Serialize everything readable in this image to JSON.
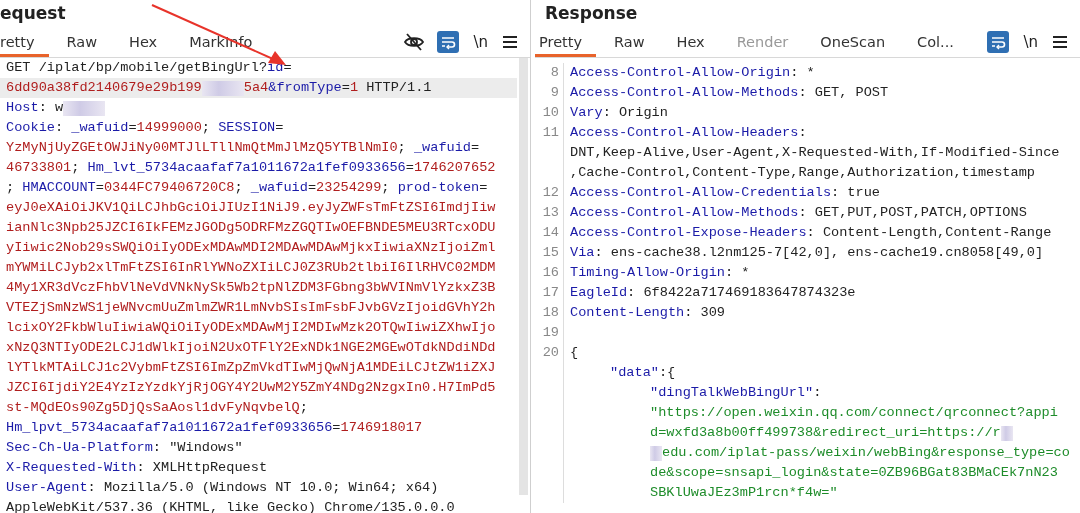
{
  "request": {
    "title": "equest",
    "tabs": [
      {
        "label": "retty",
        "selected": true,
        "disabled": false
      },
      {
        "label": "Raw",
        "selected": false,
        "disabled": false
      },
      {
        "label": "Hex",
        "selected": false,
        "disabled": false
      },
      {
        "label": "MarkInfo",
        "selected": false,
        "disabled": false
      }
    ],
    "toolbar": {
      "newline_label": "\\n"
    },
    "lines": [
      {
        "highlighted": false,
        "segments": [
          {
            "kind": "plain",
            "text": "GET /iplat/bp/mobile/getBingUrl?"
          },
          {
            "kind": "key",
            "text": "id"
          },
          {
            "kind": "plain",
            "text": "="
          }
        ]
      },
      {
        "highlighted": true,
        "segments": [
          {
            "kind": "value",
            "text": "6dd90a38fd2140679e29b199"
          },
          {
            "kind": "redacted"
          },
          {
            "kind": "value",
            "text": "5a4"
          },
          {
            "kind": "key",
            "text": "&fromType"
          },
          {
            "kind": "plain",
            "text": "="
          },
          {
            "kind": "value",
            "text": "1"
          },
          {
            "kind": "plain",
            "text": " HTTP/1.1"
          }
        ]
      },
      {
        "highlighted": false,
        "segments": [
          {
            "kind": "key",
            "text": "Host"
          },
          {
            "kind": "plain",
            "text": ": w"
          },
          {
            "kind": "redacted"
          }
        ]
      },
      {
        "highlighted": false,
        "segments": [
          {
            "kind": "key",
            "text": "Cookie"
          },
          {
            "kind": "plain",
            "text": ": "
          },
          {
            "kind": "key",
            "text": "_wafuid"
          },
          {
            "kind": "plain",
            "text": "="
          },
          {
            "kind": "value",
            "text": "14999000"
          },
          {
            "kind": "plain",
            "text": "; "
          },
          {
            "kind": "key",
            "text": "SESSION"
          },
          {
            "kind": "plain",
            "text": "="
          }
        ]
      },
      {
        "highlighted": false,
        "segments": [
          {
            "kind": "value",
            "text": "YzMyNjUyZGEtOWJiNy00MTJlLTllNmQtMmJlMzQ5YTBlNmI0"
          },
          {
            "kind": "plain",
            "text": "; "
          },
          {
            "kind": "key",
            "text": "_wafuid"
          },
          {
            "kind": "plain",
            "text": "="
          }
        ]
      },
      {
        "highlighted": false,
        "segments": [
          {
            "kind": "value",
            "text": "46733801"
          },
          {
            "kind": "plain",
            "text": "; "
          },
          {
            "kind": "key",
            "text": "Hm_lvt_5734acaafaf7a1011672a1fef0933656"
          },
          {
            "kind": "plain",
            "text": "="
          },
          {
            "kind": "value",
            "text": "1746207652"
          }
        ]
      },
      {
        "highlighted": false,
        "segments": [
          {
            "kind": "plain",
            "text": "; "
          },
          {
            "kind": "key",
            "text": "HMACCOUNT"
          },
          {
            "kind": "plain",
            "text": "="
          },
          {
            "kind": "value",
            "text": "0344FC79406720C8"
          },
          {
            "kind": "plain",
            "text": "; "
          },
          {
            "kind": "key",
            "text": "_wafuid"
          },
          {
            "kind": "plain",
            "text": "="
          },
          {
            "kind": "value",
            "text": "23254299"
          },
          {
            "kind": "plain",
            "text": "; "
          },
          {
            "kind": "key",
            "text": "prod-token"
          },
          {
            "kind": "plain",
            "text": "="
          }
        ]
      },
      {
        "highlighted": false,
        "segments": [
          {
            "kind": "value",
            "text": "eyJ0eXAiOiJKV1QiLCJhbGciOiJIUzI1NiJ9.eyJyZWFsTmFtZSI6ImdjIiw"
          }
        ]
      },
      {
        "highlighted": false,
        "segments": [
          {
            "kind": "value",
            "text": "ianNlc3Npb25JZCI6IkFEMzJGODg5ODRFMzZGQTIwOEFBNDE5MEU3RTcxODU"
          }
        ]
      },
      {
        "highlighted": false,
        "segments": [
          {
            "kind": "value",
            "text": "yIiwic2Nob29sSWQiOiIyODExMDAwMDI2MDAwMDAwMjkxIiwiaXNzIjoiZml"
          }
        ]
      },
      {
        "highlighted": false,
        "segments": [
          {
            "kind": "value",
            "text": "mYWMiLCJyb2xlTmFtZSI6InRlYWNoZXIiLCJ0Z3RUb2tlbiI6IlRHVC02MDM"
          }
        ]
      },
      {
        "highlighted": false,
        "segments": [
          {
            "kind": "value",
            "text": "4My1XR3dVczFhbVlNeVdVNkNySk5Wb2tpNlZDM3FGbng3bWVINmVlYzkxZ3B"
          }
        ]
      },
      {
        "highlighted": false,
        "segments": [
          {
            "kind": "value",
            "text": "VTEZjSmNzWS1jeWNvcmUuZmlmZWR1LmNvbSIsImFsbFJvbGVzIjoidGVhY2h"
          }
        ]
      },
      {
        "highlighted": false,
        "segments": [
          {
            "kind": "value",
            "text": "lcixOY2FkbWluIiwiaWQiOiIyODExMDAwMjI2MDIwMzk2OTQwIiwiZXhwIjo"
          }
        ]
      },
      {
        "highlighted": false,
        "segments": [
          {
            "kind": "value",
            "text": "xNzQ3NTIyODE2LCJ1dWlkIjoiN2UxOTFlY2ExNDk1NGE2MGEwOTdkNDdiNDd"
          }
        ]
      },
      {
        "highlighted": false,
        "segments": [
          {
            "kind": "value",
            "text": "lYTlkMTAiLCJ1c2VybmFtZSI6ImZpZmVkdTIwMjQwNjA1MDEiLCJtZW1iZXJ"
          }
        ]
      },
      {
        "highlighted": false,
        "segments": [
          {
            "kind": "value",
            "text": "JZCI6IjdiY2E4YzIzYzdkYjRjOGY4Y2UwM2Y5ZmY4NDg2NzgxIn0.H7ImPd5"
          }
        ]
      },
      {
        "highlighted": false,
        "segments": [
          {
            "kind": "value",
            "text": "st-MQdEOs90Zg5DjQsSaAosl1dvFyNqvbelQ"
          },
          {
            "kind": "plain",
            "text": ";"
          }
        ]
      },
      {
        "highlighted": false,
        "segments": [
          {
            "kind": "key",
            "text": "Hm_lpvt_5734acaafaf7a1011672a1fef0933656"
          },
          {
            "kind": "plain",
            "text": "="
          },
          {
            "kind": "value",
            "text": "1746918017"
          }
        ]
      },
      {
        "highlighted": false,
        "segments": [
          {
            "kind": "key",
            "text": "Sec-Ch-Ua-Platform"
          },
          {
            "kind": "plain",
            "text": ": \"Windows\""
          }
        ]
      },
      {
        "highlighted": false,
        "segments": [
          {
            "kind": "key",
            "text": "X-Requested-With"
          },
          {
            "kind": "plain",
            "text": ": XMLHttpRequest"
          }
        ]
      },
      {
        "highlighted": false,
        "segments": [
          {
            "kind": "key",
            "text": "User-Agent"
          },
          {
            "kind": "plain",
            "text": ": Mozilla/5.0 (Windows NT 10.0; Win64; x64)"
          }
        ]
      },
      {
        "highlighted": false,
        "segments": [
          {
            "kind": "plain",
            "text": "AppleWebKit/537.36 (KHTML, like Gecko) Chrome/135.0.0.0"
          }
        ]
      }
    ]
  },
  "response": {
    "title": "Response",
    "tabs": [
      {
        "label": "Pretty",
        "selected": true,
        "disabled": false
      },
      {
        "label": "Raw",
        "selected": false,
        "disabled": false
      },
      {
        "label": "Hex",
        "selected": false,
        "disabled": false
      },
      {
        "label": "Render",
        "selected": false,
        "disabled": true
      },
      {
        "label": "OneScan",
        "selected": false,
        "disabled": false
      },
      {
        "label": "Col...",
        "selected": false,
        "disabled": false
      }
    ],
    "toolbar": {
      "newline_label": "\\n"
    },
    "lines": [
      {
        "number": "8",
        "rows": [
          [
            {
              "kind": "key",
              "text": "Access-Control-Allow-Origin"
            },
            {
              "kind": "plain",
              "text": ": *"
            }
          ]
        ]
      },
      {
        "number": "9",
        "rows": [
          [
            {
              "kind": "key",
              "text": "Access-Control-Allow-Methods"
            },
            {
              "kind": "plain",
              "text": ": GET, POST"
            }
          ]
        ]
      },
      {
        "number": "10",
        "rows": [
          [
            {
              "kind": "key",
              "text": "Vary"
            },
            {
              "kind": "plain",
              "text": ": Origin"
            }
          ]
        ]
      },
      {
        "number": "11",
        "rows": [
          [
            {
              "kind": "key",
              "text": "Access-Control-Allow-Headers"
            },
            {
              "kind": "plain",
              "text": ":"
            }
          ],
          [
            {
              "kind": "plain",
              "text": "DNT,Keep-Alive,User-Agent,X-Requested-With,If-Modified-Since"
            }
          ],
          [
            {
              "kind": "plain",
              "text": ",Cache-Control,Content-Type,Range,Authorization,timestamp"
            }
          ]
        ]
      },
      {
        "number": "12",
        "rows": [
          [
            {
              "kind": "key",
              "text": "Access-Control-Allow-Credentials"
            },
            {
              "kind": "plain",
              "text": ": true"
            }
          ]
        ]
      },
      {
        "number": "13",
        "rows": [
          [
            {
              "kind": "key",
              "text": "Access-Control-Allow-Methods"
            },
            {
              "kind": "plain",
              "text": ": GET,PUT,POST,PATCH,OPTIONS"
            }
          ]
        ]
      },
      {
        "number": "14",
        "rows": [
          [
            {
              "kind": "key",
              "text": "Access-Control-Expose-Headers"
            },
            {
              "kind": "plain",
              "text": ": Content-Length,Content-Range"
            }
          ]
        ]
      },
      {
        "number": "15",
        "rows": [
          [
            {
              "kind": "key",
              "text": "Via"
            },
            {
              "kind": "plain",
              "text": ": ens-cache38.l2nm125-7[42,0], ens-cache19.cn8058[49,0]"
            }
          ]
        ]
      },
      {
        "number": "16",
        "rows": [
          [
            {
              "kind": "key",
              "text": "Timing-Allow-Origin"
            },
            {
              "kind": "plain",
              "text": ": *"
            }
          ]
        ]
      },
      {
        "number": "17",
        "rows": [
          [
            {
              "kind": "key",
              "text": "EagleId"
            },
            {
              "kind": "plain",
              "text": ": 6f8422a717469183647874323e"
            }
          ]
        ]
      },
      {
        "number": "18",
        "rows": [
          [
            {
              "kind": "key",
              "text": "Content-Length"
            },
            {
              "kind": "plain",
              "text": ": 309"
            }
          ]
        ]
      },
      {
        "number": "19",
        "rows": [
          []
        ]
      },
      {
        "number": "20",
        "rows": [
          [
            {
              "kind": "plain",
              "text": "{"
            }
          ]
        ],
        "children": [
          {
            "rows": [
              [
                {
                  "kind": "key",
                  "text": "\"data\""
                },
                {
                  "kind": "plain",
                  "text": ":{"
                }
              ]
            ],
            "children": [
              {
                "rows": [
                  [
                    {
                      "kind": "key",
                      "text": "\"dingTalkWebBingUrl\""
                    },
                    {
                      "kind": "plain",
                      "text": ":"
                    }
                  ],
                  [
                    {
                      "kind": "string",
                      "text": "\"https://open.weixin.qq.com/connect/qrconnect?appi"
                    }
                  ],
                  [
                    {
                      "kind": "string",
                      "text": "d=wxfd3a8b00ff499738&redirect_uri=https://r"
                    },
                    {
                      "kind": "redacted"
                    }
                  ],
                  [
                    {
                      "kind": "redacted"
                    },
                    {
                      "kind": "string",
                      "text": "edu.com/iplat-pass/weixin/webBing&response_type=co"
                    }
                  ],
                  [
                    {
                      "kind": "string",
                      "text": "de&scope=snsapi_login&state=0ZB96BGat83BMaCEk7nN23"
                    }
                  ],
                  [
                    {
                      "kind": "string",
                      "text": "SBKlUwaJEz3mP1rcn*f4w=\""
                    }
                  ]
                ]
              }
            ]
          }
        ]
      }
    ]
  }
}
